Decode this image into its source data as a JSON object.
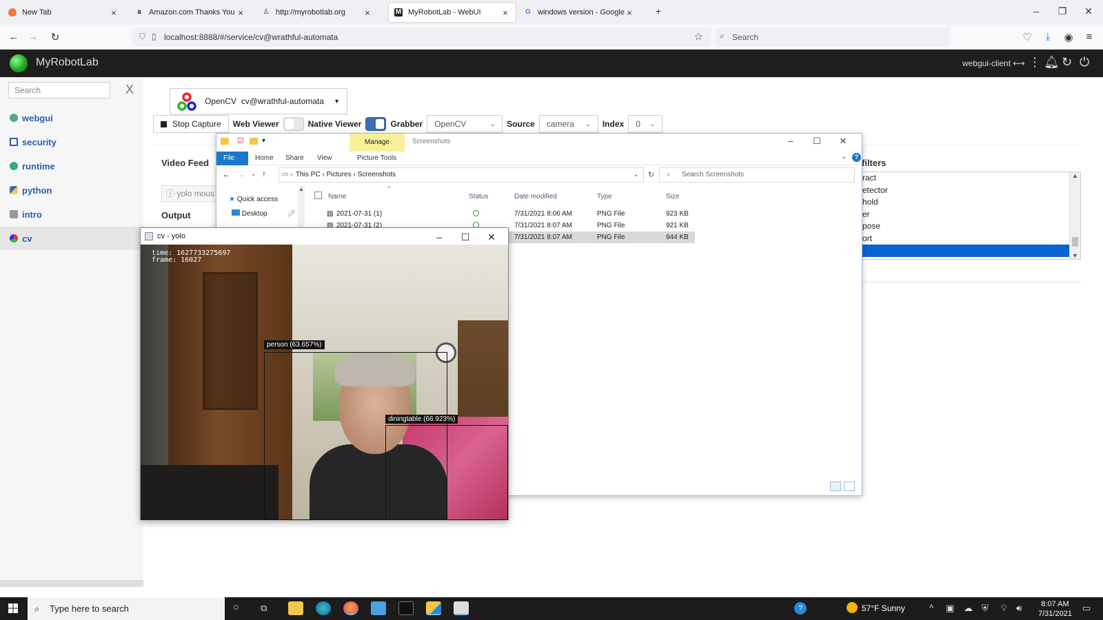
{
  "browser": {
    "tabs": [
      {
        "title": "New Tab"
      },
      {
        "title": "Amazon.com Thanks You"
      },
      {
        "title": "http://myrobotlab.org"
      },
      {
        "title": "MyRobotLab - WebUI"
      },
      {
        "title": "windows version - Google Searc"
      }
    ],
    "url": "localhost:8888/#/service/cv@wrathful-automata",
    "search_placeholder": "Search"
  },
  "app": {
    "title": "MyRobotLab",
    "client": "webgui-client",
    "search_placeholder": "Search",
    "sidebar": [
      {
        "label": "webgui"
      },
      {
        "label": "security"
      },
      {
        "label": "runtime"
      },
      {
        "label": "python"
      },
      {
        "label": "intro"
      },
      {
        "label": "cv"
      }
    ],
    "service": {
      "type": "OpenCV",
      "name": "cv@wrathful-automata"
    },
    "toolbar": {
      "stop_capture": "Stop Capture",
      "web_viewer": "Web Viewer",
      "native_viewer": "Native Viewer",
      "grabber_label": "Grabber",
      "grabber_value": "OpenCV",
      "source_label": "Source",
      "source_value": "camera",
      "index_label": "Index",
      "index_value": "0"
    },
    "video_feed": "Video Feed",
    "yolo_hint": "yolo mous",
    "output": "Output",
    "filters": {
      "heading": "filters",
      "items": [
        "ract",
        "etector",
        "hold",
        "er",
        "pose",
        "ort",
        ""
      ],
      "selected": 6
    }
  },
  "explorer": {
    "manage": "Manage",
    "title": "Screenshots",
    "ribbon": [
      "File",
      "Home",
      "Share",
      "View",
      "Picture Tools"
    ],
    "path": [
      "This PC",
      "Pictures",
      "Screenshots"
    ],
    "search_placeholder": "Search Screenshots",
    "nav": [
      "Quick access",
      "Desktop"
    ],
    "columns": [
      "Name",
      "Status",
      "Date modified",
      "Type",
      "Size"
    ],
    "rows": [
      {
        "name": "2021-07-31 (1)",
        "date": "7/31/2021 8:06 AM",
        "type": "PNG File",
        "size": "923 KB"
      },
      {
        "name": "2021-07-31 (2)",
        "date": "7/31/2021 8:07 AM",
        "type": "PNG File",
        "size": "921 KB"
      },
      {
        "name": "",
        "date": "7/31/2021 8:07 AM",
        "type": "PNG File",
        "size": "944 KB"
      }
    ]
  },
  "yolo_window": {
    "title": "cv - yolo",
    "time_line": "time: 1627733275697",
    "frame_line": "frame: 16027",
    "detections": [
      {
        "label": "person (63.657%)"
      },
      {
        "label": "diningtable (66.923%)"
      }
    ]
  },
  "taskbar": {
    "search_placeholder": "Type here to search",
    "weather": "57°F  Sunny",
    "time": "8:07 AM",
    "date": "7/31/2021"
  },
  "colors": {
    "appbar": "#1e1e1e",
    "link": "#2a5db0",
    "selection": "#0a64d2",
    "explorer_file_tab": "#1979ca",
    "manage_tab": "#fbf09a"
  }
}
